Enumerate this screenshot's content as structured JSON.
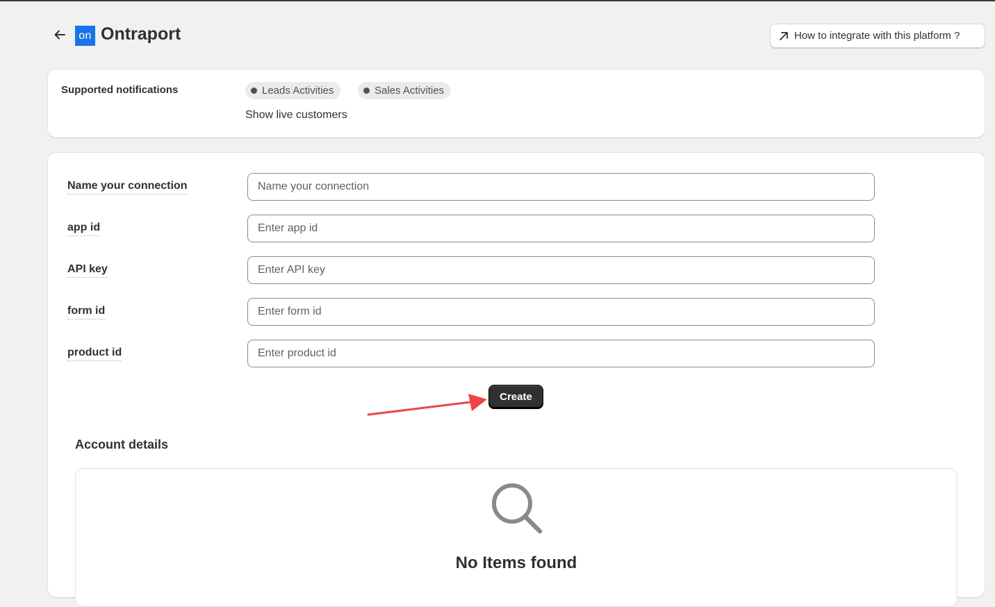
{
  "header": {
    "back_icon": "arrow-left-icon",
    "logo_text": "on",
    "title": "Ontraport",
    "help_label": "How to integrate with this platform ?",
    "help_icon": "arrow-up-right-icon"
  },
  "notifications": {
    "label": "Supported notifications",
    "chips": [
      "Leads Activities",
      "Sales Activities"
    ],
    "live_text": "Show live customers"
  },
  "form": {
    "fields": [
      {
        "label": "Name your connection",
        "placeholder": "Name your connection",
        "value": ""
      },
      {
        "label": "app id",
        "placeholder": "Enter app id",
        "value": ""
      },
      {
        "label": "API key",
        "placeholder": "Enter API key",
        "value": ""
      },
      {
        "label": "form id",
        "placeholder": "Enter form id",
        "value": ""
      },
      {
        "label": "product id",
        "placeholder": "Enter product id",
        "value": ""
      }
    ],
    "create_label": "Create"
  },
  "account": {
    "title": "Account details",
    "empty_icon": "search-icon",
    "empty_text": "No Items found"
  },
  "colors": {
    "background": "#f1f1f1",
    "logo_bg": "#1a73e8",
    "primary_button": "#303030",
    "annotation_arrow": "#ef4444"
  }
}
